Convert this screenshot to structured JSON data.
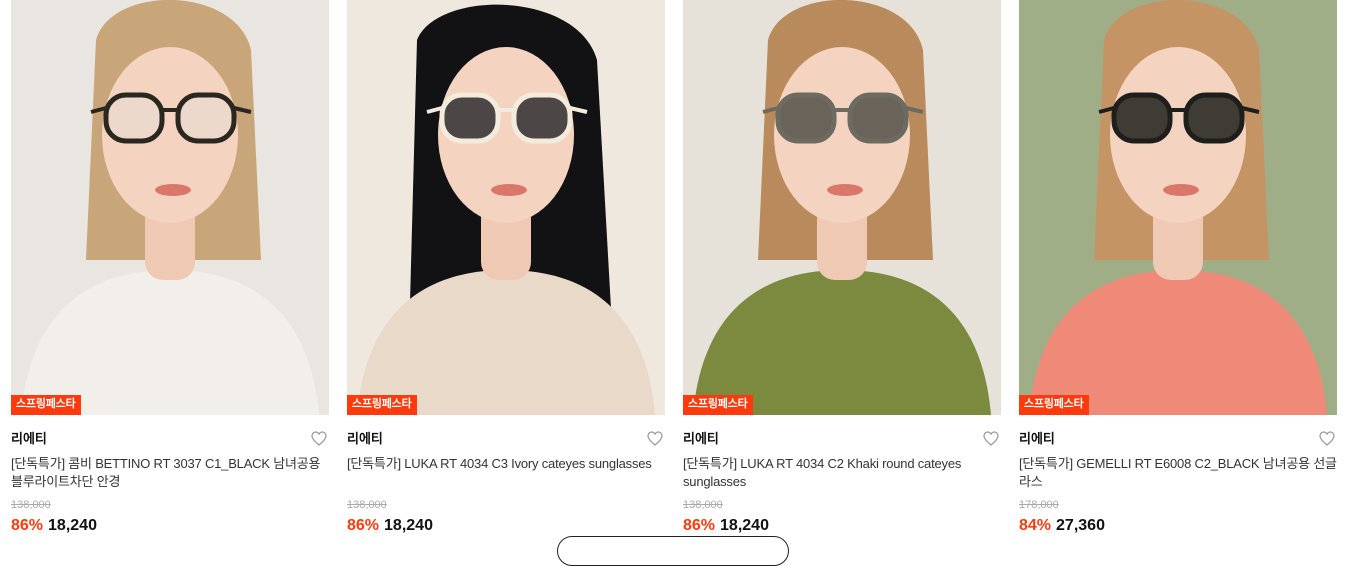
{
  "products": [
    {
      "badge": "스프링페스타",
      "brand": "리에티",
      "title": "[단독특가] 콤비 BETTINO RT 3037 C1_BLACK 남녀공용 블루라이트차단 안경",
      "original_price": "138,000",
      "discount": "86%",
      "price": "18,240",
      "bg": "#e9e6e1",
      "shirt": "#f2efea",
      "hair": "#c9a57a",
      "lens": "#dfe3e2",
      "frame": "#2a2620"
    },
    {
      "badge": "스프링페스타",
      "brand": "리에티",
      "title": "[단독특가] LUKA RT 4034 C3 Ivory cateyes sunglasses",
      "original_price": "138,000",
      "discount": "86%",
      "price": "18,240",
      "bg": "#efe8df",
      "shirt": "#e8d9c9",
      "hair": "#121214",
      "lens": "#3a3638",
      "frame": "#f3ecdc"
    },
    {
      "badge": "스프링페스타",
      "brand": "리에티",
      "title": "[단독특가] LUKA RT 4034 C2 Khaki round cateyes sunglasses",
      "original_price": "138,000",
      "discount": "86%",
      "price": "18,240",
      "bg": "#e6e1d9",
      "shirt": "#7b8a3e",
      "hair": "#b98a5c",
      "lens": "#5b574e",
      "frame": "#6d6a5f"
    },
    {
      "badge": "스프링페스타",
      "brand": "리에티",
      "title": "[단독특가] GEMELLI RT E6008 C2_BLACK 남녀공용 선글라스",
      "original_price": "178,000",
      "discount": "84%",
      "price": "27,360",
      "bg": "#9fae86",
      "shirt": "#f08a78",
      "hair": "#c49465",
      "lens": "#2a2b26",
      "frame": "#1e1e1c"
    }
  ],
  "colors": {
    "accent": "#ff3a0d",
    "text": "#111111",
    "muted": "#aaaaaa"
  },
  "icons": {
    "wishlist": "heart-outline-icon"
  }
}
